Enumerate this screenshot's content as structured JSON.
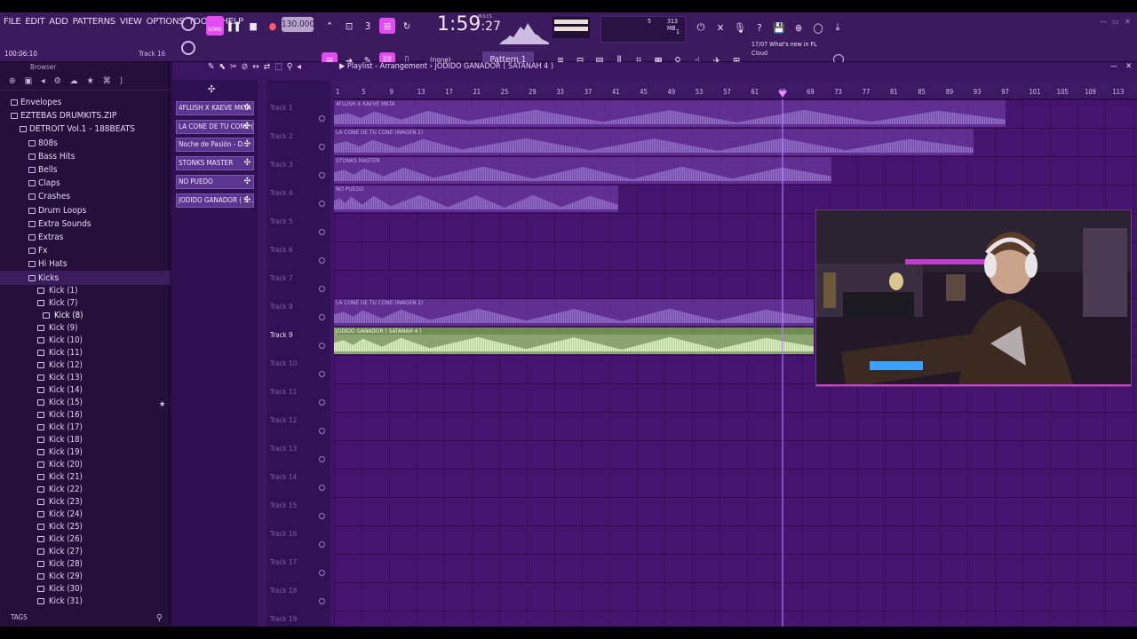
{
  "menu": [
    "FILE",
    "EDIT",
    "ADD",
    "PATTERNS",
    "VIEW",
    "OPTIONS",
    "TOOLS",
    "HELP"
  ],
  "toolbar": {
    "time_small": "100:06:10",
    "track_hint": "Track 16",
    "song_mode": "SONG",
    "tempo": "130.000",
    "clock_main": "1:59",
    "clock_sub": ":27",
    "clock_label": "M:S:CS",
    "mem_cpu": "5",
    "mem_ram": "313 MB",
    "mem_poly": "1",
    "snap": "(none)",
    "pattern": "Pattern 1",
    "news_date": "17/07",
    "news_text": "What's new in FL",
    "news_sub": "Cloud"
  },
  "browser": {
    "title": "Browser",
    "top_items": [
      "Envelopes",
      "EZTEBAS DRUMKITS.ZIP",
      "DETROIT Vol.1 - 188BEATS"
    ],
    "folders": [
      "808s",
      "Bass Hits",
      "Bells",
      "Claps",
      "Crashes",
      "Drum Loops",
      "Extra Sounds",
      "Extras",
      "Fx",
      "Hi Hats",
      "Kicks"
    ],
    "kicks": [
      "Kick (1)",
      "Kick (7)",
      "Kick (8)",
      "Kick (9)",
      "Kick (10)",
      "Kick (11)",
      "Kick (12)",
      "Kick (13)",
      "Kick (14)",
      "Kick (15)",
      "Kick (16)",
      "Kick (17)",
      "Kick (18)",
      "Kick (19)",
      "Kick (20)",
      "Kick (21)",
      "Kick (22)",
      "Kick (23)",
      "Kick (24)",
      "Kick (25)",
      "Kick (26)",
      "Kick (27)",
      "Kick (28)",
      "Kick (29)",
      "Kick (30)",
      "Kick (31)"
    ],
    "tags": "TAGS"
  },
  "playlist": {
    "title": "Playlist - Arrangement",
    "arrangement": "JODIDO GANADOR ( SATANAH 4 )",
    "clip_buttons": [
      "4FLUSH X KAEVE MKTA",
      "LA CONE DE TU CONE (...",
      "Noche de Pasión - D...",
      "STONKS MASTER",
      "NO PUEDO",
      "JODIDO GANADOR ( S..."
    ],
    "ruler": [
      "1",
      "5",
      "9",
      "13",
      "17",
      "21",
      "25",
      "29",
      "33",
      "37",
      "41",
      "45",
      "49",
      "53",
      "57",
      "61",
      "65",
      "69",
      "73",
      "77",
      "81",
      "85",
      "89",
      "93",
      "97",
      "101",
      "105",
      "109",
      "113"
    ],
    "tracks": [
      "Track 1",
      "Track 2",
      "Track 3",
      "Track 4",
      "Track 5",
      "Track 6",
      "Track 7",
      "Track 8",
      "Track 9",
      "Track 10",
      "Track 11",
      "Track 12",
      "Track 13",
      "Track 14",
      "Track 15",
      "Track 16",
      "Track 17",
      "Track 18",
      "Track 19"
    ],
    "active_track": "Track 9",
    "clips": [
      {
        "label": "4FLUSH X KAEVE MKTA",
        "track": 1
      },
      {
        "label": "LA CONE DE TU CONE (WAGEN 2)",
        "track": 2
      },
      {
        "label": "STONKS MASTER",
        "track": 3
      },
      {
        "label": "NO PUEDO",
        "track": 4
      },
      {
        "label": "LA CONE DE TU CONE (WAGEN 2)",
        "track": 8
      },
      {
        "label": "JODIDO GANADOR ( SATANAH 4 )",
        "track": 9
      }
    ]
  }
}
